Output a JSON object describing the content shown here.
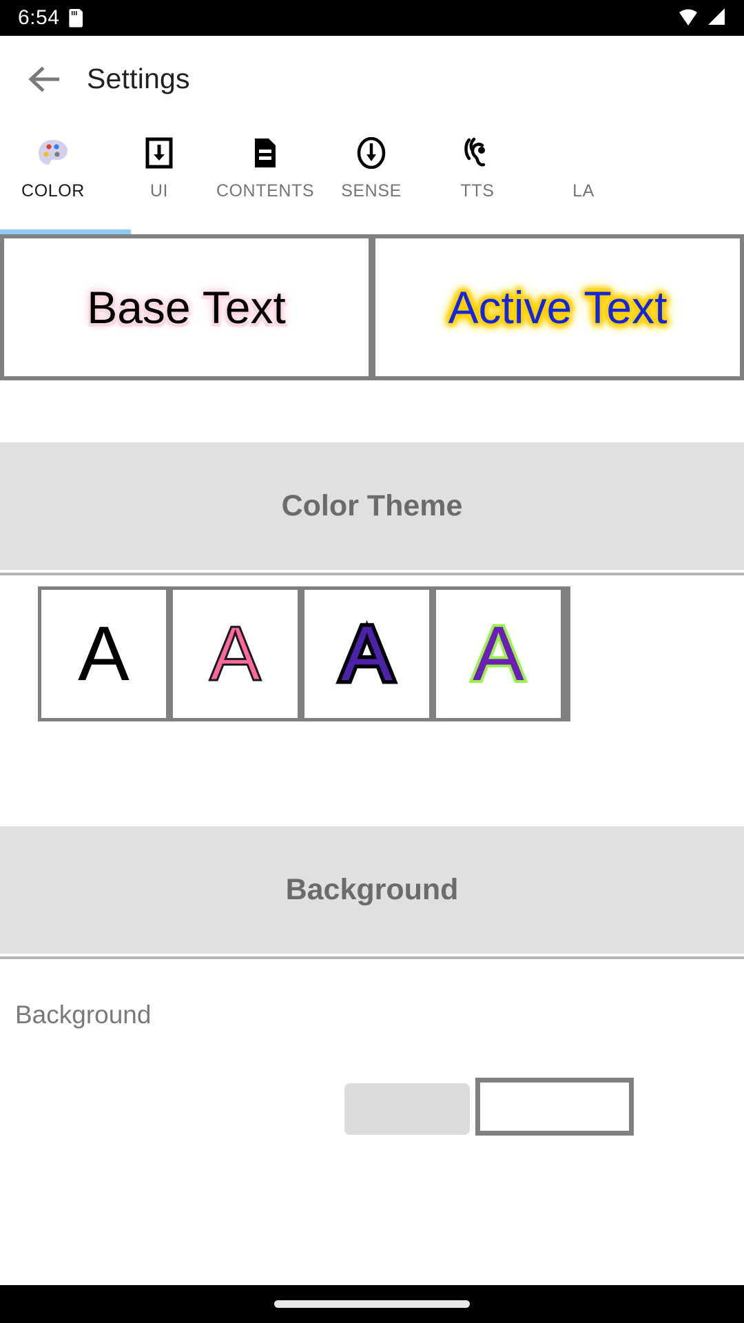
{
  "status_bar": {
    "time": "6:54",
    "icons": [
      "sd-card-icon",
      "wifi-icon",
      "signal-icon"
    ]
  },
  "app_bar": {
    "back_icon": "back-arrow-icon",
    "title": "Settings"
  },
  "tabs": {
    "selected_index": 0,
    "indicator_color": "#90caf9",
    "items": [
      {
        "label": "COLOR",
        "icon": "palette-icon"
      },
      {
        "label": "UI",
        "icon": "download-box-icon"
      },
      {
        "label": "CONTENTS",
        "icon": "document-icon"
      },
      {
        "label": "SENSE",
        "icon": "circle-down-arrow-icon"
      },
      {
        "label": "TTS",
        "icon": "hearing-icon"
      },
      {
        "label": "LA",
        "icon": "language-icon"
      }
    ]
  },
  "preview": {
    "base": {
      "text": "Base Text",
      "text_color": "#000000",
      "glow_color": "#f9d7de"
    },
    "active": {
      "text": "Active Text",
      "text_color": "#1226e0",
      "glow_color": "#ffd000"
    }
  },
  "color_theme_section": {
    "title": "Color Theme",
    "swatches": [
      {
        "letter": "A",
        "name": "theme-black",
        "fill": "#000000",
        "stroke": ""
      },
      {
        "letter": "A",
        "name": "theme-pink",
        "fill": "#ff69a0",
        "stroke": "#1a1a1a"
      },
      {
        "letter": "A",
        "name": "theme-purple-black",
        "fill": "#4b22a8",
        "stroke": "#000000"
      },
      {
        "letter": "A",
        "name": "theme-purple-green",
        "fill": "#6a1fb5",
        "stroke": "#9cf24d"
      }
    ]
  },
  "background_section": {
    "title": "Background",
    "row_label": "Background"
  },
  "nav_bar": {
    "home_indicator": "home-pill"
  }
}
